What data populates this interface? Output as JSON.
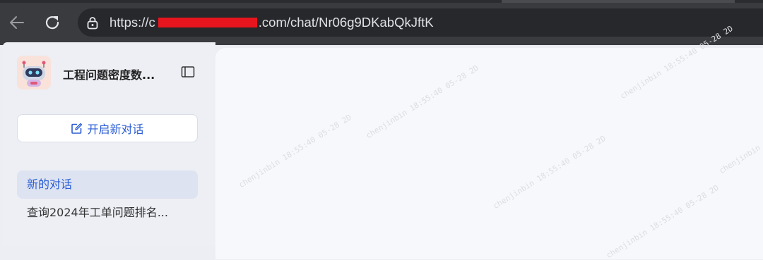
{
  "browser": {
    "url_prefix": "https://",
    "url_first_char": "c",
    "url_suffix": ".com/chat/Nr06g9DKabQkJftK"
  },
  "sidebar": {
    "app_title": "工程问题密度数...",
    "new_chat_label": "开启新对话",
    "history": [
      {
        "label": "新的对话",
        "active": true
      },
      {
        "label": "查询2024年工单问题排名..."
      }
    ]
  },
  "watermark": {
    "text": "chenjinbin 18:55:40 05-28 2D"
  },
  "colors": {
    "accent": "#2b5cd6",
    "active_bg": "#dde3f0",
    "browser_bar": "#3a3b3e"
  }
}
